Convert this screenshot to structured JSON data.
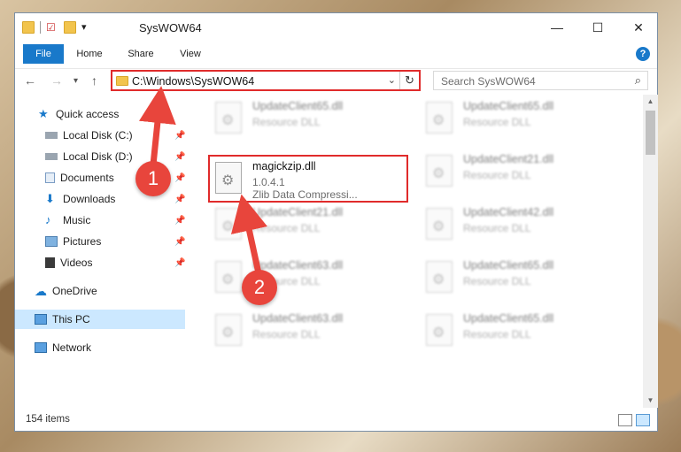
{
  "window": {
    "title": "SysWOW64"
  },
  "ribbon": {
    "tabs": [
      "File",
      "Home",
      "Share",
      "View"
    ],
    "help": "?"
  },
  "address": {
    "path": "C:\\Windows\\SysWOW64"
  },
  "search": {
    "placeholder": "Search SysWOW64"
  },
  "sidebar": {
    "items": [
      {
        "label": "Quick access",
        "icon": "star-icon"
      },
      {
        "label": "Local Disk (C:)",
        "icon": "drive-icon"
      },
      {
        "label": "Local Disk (D:)",
        "icon": "drive-icon"
      },
      {
        "label": "Documents",
        "icon": "documents-icon"
      },
      {
        "label": "Downloads",
        "icon": "download-icon"
      },
      {
        "label": "Music",
        "icon": "music-icon"
      },
      {
        "label": "Pictures",
        "icon": "pictures-icon"
      },
      {
        "label": "Videos",
        "icon": "videos-icon"
      },
      {
        "label": "OneDrive",
        "icon": "cloud-icon"
      },
      {
        "label": "This PC",
        "icon": "computer-icon"
      },
      {
        "label": "Network",
        "icon": "network-icon"
      }
    ]
  },
  "files": [
    {
      "name": "UpdateClient65.dll",
      "desc": "Resource DLL"
    },
    {
      "name": "UpdateClient65.dll",
      "desc": "Resource DLL"
    },
    {
      "name": "magickzip.dll",
      "version": "1.0.4.1",
      "desc": "Zlib Data Compressi..."
    },
    {
      "name": "UpdateClient21.dll",
      "desc": "Resource DLL"
    },
    {
      "name": "UpdateClient21.dll",
      "desc": "Resource DLL"
    },
    {
      "name": "UpdateClient42.dll",
      "desc": "Resource DLL"
    },
    {
      "name": "UpdateClient63.dll",
      "desc": "Resource DLL"
    },
    {
      "name": "UpdateClient65.dll",
      "desc": "Resource DLL"
    },
    {
      "name": "UpdateClient63.dll",
      "desc": "Resource DLL"
    },
    {
      "name": "UpdateClient65.dll",
      "desc": "Resource DLL"
    }
  ],
  "status": {
    "count": "154 items"
  },
  "annotations": {
    "step1": "1",
    "step2": "2"
  },
  "colors": {
    "accent": "#1979ca",
    "highlight": "#e02b2b",
    "badge": "#e8453c"
  }
}
